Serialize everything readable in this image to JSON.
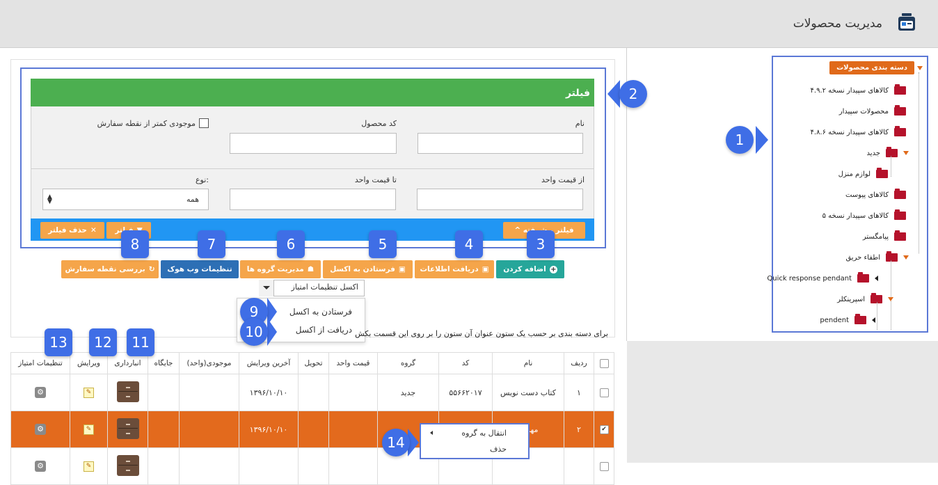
{
  "header": {
    "title": "مدیریت محصولات",
    "icon": "product-management-icon"
  },
  "tree": {
    "root": "دسته بندی محصولات",
    "items": [
      {
        "label": "کالاهای سپیدار نسخه ۴.۹.۲"
      },
      {
        "label": "محصولات سپیدار"
      },
      {
        "label": "کالاهای سپیدار نسخه ۴.۸.۶"
      },
      {
        "label": "جدید"
      },
      {
        "label": "لوازم منزل"
      },
      {
        "label": "کالاهای پیوست"
      },
      {
        "label": "کالاهای سپیدار نسخه ۵"
      },
      {
        "label": "پیامگستر"
      },
      {
        "label": "اطفاء حریق"
      },
      {
        "label": "Quick response pendant"
      },
      {
        "label": "اسپرینکلر"
      },
      {
        "label": "pendent"
      }
    ]
  },
  "filter": {
    "title": "فیلتر",
    "name_label": "نام",
    "code_label": "کد محصول",
    "low_stock_label": "موجودی کمتر از نقطه سفارش",
    "from_price_label": "از قیمت واحد",
    "to_price_label": "تا قیمت واحد",
    "type_label": "نوع:",
    "type_value": "همه",
    "advanced_label": "^ فیلتر پیشرفته",
    "apply_label": "فیلتر",
    "clear_label": "حذف فیلتر"
  },
  "toolbar": {
    "add": "اضافه کردن",
    "import": "دریافت اطلاعات",
    "export": "فرستادن به اکسل",
    "groups": "مدیریت گروه ها",
    "webhook": "تنظیمات وب هوک",
    "reorder": "بررسی نقطه سفارش"
  },
  "excel": {
    "select_value": "اکسل تنظیمات امتیاز",
    "menu": [
      "فرستادن به اکسل",
      "دریافت از اکسل"
    ]
  },
  "info_text": "برای دسته بندی بر حسب یک ستون عنوان آن ستون را بر روی این قسمت بکش",
  "table": {
    "headers": [
      "ردیف",
      "نام",
      "کد",
      "گروه",
      "قیمت واحد",
      "تحویل",
      "آخرین ویرایش",
      "موجودی(واحد)",
      "جایگاه",
      "انبارداری",
      "ویرایش",
      "تنظیمات امتیاز"
    ],
    "rows": [
      {
        "index": "۱",
        "name": "کتاب دست نویس",
        "code": "۵۵۶۶۲۰۱۷",
        "group": "جدید",
        "price": "",
        "delivery": "",
        "last_edit": "۱۳۹۶/۱۰/۱۰",
        "stock": "",
        "location": "",
        "checked": false
      },
      {
        "index": "۲",
        "name": "۱۹مهر",
        "code": "",
        "group": "",
        "price": "",
        "delivery": "",
        "last_edit": "۱۳۹۶/۱۰/۱۰",
        "stock": "",
        "location": "",
        "checked": true
      }
    ]
  },
  "context_menu": [
    "انتقال به گروه",
    "حذف"
  ],
  "badges": [
    "1",
    "2",
    "3",
    "4",
    "5",
    "6",
    "7",
    "8",
    "9",
    "10",
    "11",
    "12",
    "13",
    "14"
  ],
  "colors": {
    "accent_orange": "#e36a1d",
    "filter_green": "#4caf50",
    "bar_blue": "#2196f3",
    "badge_blue": "#3f6ee6",
    "button_orange": "#f5a54a",
    "webhook_blue": "#2d6fb5",
    "add_green": "#26a69a"
  }
}
